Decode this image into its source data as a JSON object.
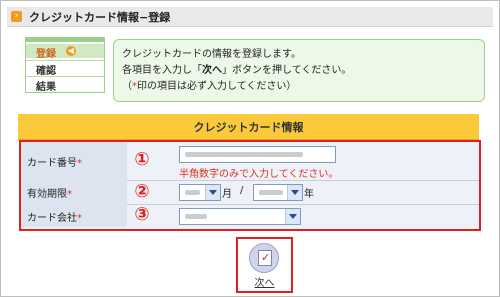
{
  "title": "クレジットカード情報−登録",
  "steps": [
    {
      "label": "登録",
      "active": true
    },
    {
      "label": "確認",
      "active": false
    },
    {
      "label": "結果",
      "active": false
    }
  ],
  "info": {
    "line1": "クレジットカードの情報を登録します。",
    "line2_prefix": "各項目を入力し「",
    "line2_bold": "次へ",
    "line2_suffix": "」ボタンを押してください。",
    "line3_open": "（",
    "line3_star": "*",
    "line3_rest": "印の項目は必ず入力してください）"
  },
  "form": {
    "header": "クレジットカード情報",
    "card_number": {
      "label": "カード番号",
      "required": "*",
      "marker": "①",
      "hint": "半角数字のみで入力してください。"
    },
    "expiry": {
      "label": "有効期限",
      "required": "*",
      "marker": "②",
      "month_unit": "月",
      "separator": "/",
      "year_unit": "年"
    },
    "company": {
      "label": "カード会社",
      "required": "*",
      "marker": "③"
    }
  },
  "next_button": {
    "label": "次へ"
  },
  "colors": {
    "accent_orange": "#f29a1a",
    "header_yellow": "#fbc93a",
    "highlight_red": "#e02020",
    "info_green": "#eef8e8"
  }
}
